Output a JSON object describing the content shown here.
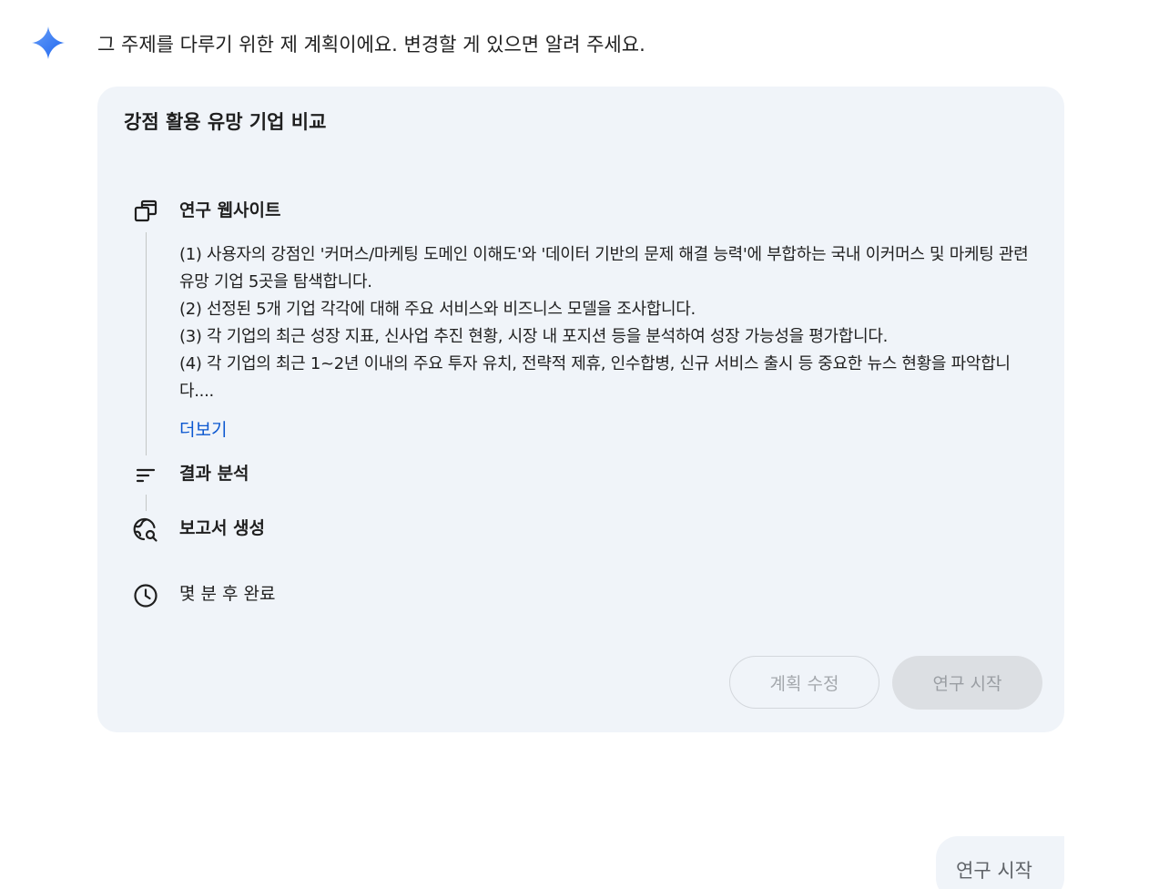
{
  "assistant": {
    "icon": "gemini-sparkle-icon",
    "intro": "그 주제를 다루기 위한 제 계획이에요. 변경할 게 있으면 알려 주세요."
  },
  "plan": {
    "title": "강점 활용 유망 기업 비교",
    "steps": [
      {
        "icon": "website-icon",
        "label": "연구 웹사이트",
        "description": [
          "(1) 사용자의 강점인 '커머스/마케팅 도메인 이해도'와 '데이터 기반의 문제 해결 능력'에 부합하는 국내 이커머스 및 마케팅 관련 유망 기업 5곳을 탐색합니다.",
          "(2) 선정된 5개 기업 각각에 대해 주요 서비스와 비즈니스 모델을 조사합니다.",
          "(3) 각 기업의 최근 성장 지표, 신사업 추진 현황, 시장 내 포지션 등을 분석하여 성장 가능성을 평가합니다.",
          "(4) 각 기업의 최근 1~2년 이내의 주요 투자 유치, 전략적 제휴, 인수합병, 신규 서비스 출시 등 중요한 뉴스 현황을 파악합니다...."
        ],
        "more_link": "더보기"
      },
      {
        "icon": "analysis-icon",
        "label": "결과 분석"
      },
      {
        "icon": "report-search-icon",
        "label": "보고서 생성"
      }
    ],
    "eta": {
      "icon": "clock-icon",
      "label": "몇 분 후 완료"
    },
    "buttons": {
      "edit": "계획 수정",
      "start": "연구 시작"
    }
  },
  "user_message": "연구 시작",
  "colors": {
    "card_background": "#f0f4f9",
    "link": "#0b57d0",
    "disabled_text": "#9a9ea3",
    "star_gradient": [
      "#4f8df5",
      "#1f6ef0"
    ]
  }
}
